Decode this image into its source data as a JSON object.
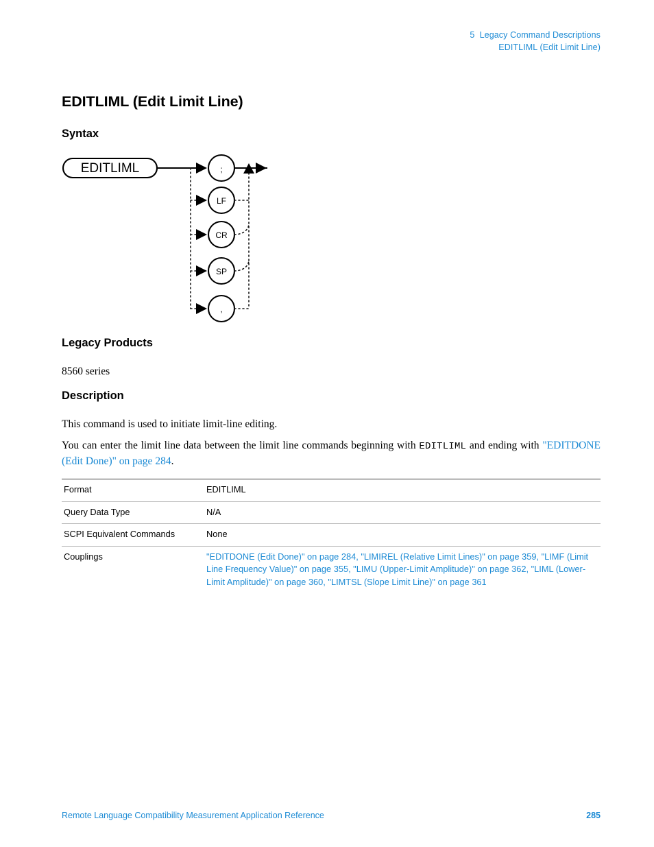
{
  "header": {
    "chapter_line": "5  Legacy Command Descriptions",
    "topic_line": "EDITLIML (Edit Limit Line)",
    "accent_color": "#1b8ad4"
  },
  "title": "EDITLIML (Edit Limit Line)",
  "sections": {
    "syntax_heading": "Syntax",
    "legacy_heading": "Legacy Products",
    "legacy_products": "8560 series",
    "description_heading": "Description",
    "description_p1": "This command is used to initiate limit-line editing.",
    "description_p2": {
      "part1": "You can enter the limit line data between the limit line commands beginning with ",
      "command": "EDITLIML",
      "part2": " and ending with ",
      "link": "\"EDITDONE (Edit Done)\" on page 284",
      "part3": "."
    }
  },
  "syntax_diagram": {
    "start_token": "EDITLIML",
    "branches": [
      ";",
      "LF",
      "CR",
      "SP",
      ","
    ],
    "line_color": "#000000"
  },
  "table": {
    "rows": [
      {
        "label": "Format",
        "value": "EDITLIML",
        "is_link": false
      },
      {
        "label": "Query Data Type",
        "value": "N/A",
        "is_link": false
      },
      {
        "label": "SCPI Equivalent Commands",
        "value": "None",
        "is_link": false
      },
      {
        "label": "Couplings",
        "value": "\"EDITDONE (Edit Done)\" on page 284, \"LIMIREL (Relative Limit Lines)\" on page 359, \"LIMF (Limit Line Frequency Value)\" on page 355, \"LIMU (Upper-Limit Amplitude)\" on page 362, \"LIML (Lower-Limit Amplitude)\" on page 360, \"LIMTSL (Slope Limit Line)\" on page 361",
        "is_link": true
      }
    ]
  },
  "footer": {
    "document_title": "Remote Language Compatibility Measurement Application Reference",
    "page_number": "285"
  }
}
